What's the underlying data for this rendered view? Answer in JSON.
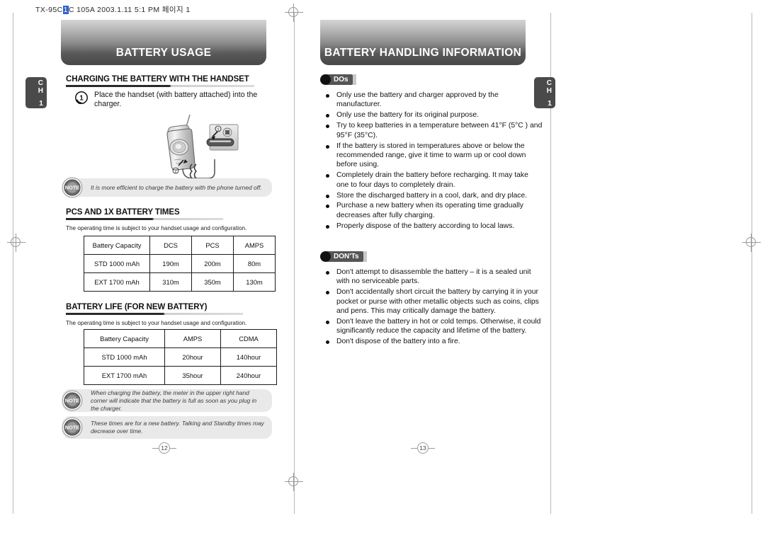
{
  "file_info": {
    "prefix": "TX-95C",
    "highlight": "1",
    "rest": "C 105A  2003.1.11 5:1 PM 페이지 1"
  },
  "left_page": {
    "banner_title": "BATTERY USAGE",
    "chapter_tab": {
      "line1": "C",
      "line2": "H",
      "number": "1"
    },
    "section1": {
      "heading": "CHARGING THE BATTERY WITH THE HANDSET"
    },
    "step1": {
      "number": "1",
      "text": "Place the handset (with battery attached) into the charger."
    },
    "note1": {
      "badge": "NOTE",
      "text": "It is more efficient to charge the battery with the phone turned off."
    },
    "section2": {
      "heading": "PCS AND 1X BATTERY TIMES",
      "caption": "The operating time is subject to your handset usage and configuration.",
      "table": {
        "headers": [
          "Battery Capacity",
          "DCS",
          "PCS",
          "AMPS"
        ],
        "rows": [
          [
            "STD 1000 mAh",
            "190m",
            "200m",
            "80m"
          ],
          [
            "EXT 1700 mAh",
            "310m",
            "350m",
            "130m"
          ]
        ]
      }
    },
    "section3": {
      "heading": "BATTERY LIFE (FOR NEW BATTERY)",
      "caption": "The operating time is subject to your handset usage and configuration.",
      "table": {
        "headers": [
          "Battery Capacity",
          "AMPS",
          "CDMA"
        ],
        "rows": [
          [
            "STD 1000 mAh",
            "20hour",
            "140hour"
          ],
          [
            "EXT 1700 mAh",
            "35hour",
            "240hour"
          ]
        ]
      }
    },
    "note2": {
      "badge": "NOTE",
      "text": "When charging the battery, the meter in the upper right hand corner will indicate that the battery is full as soon as you plug in the charger."
    },
    "note3": {
      "badge": "NOTE",
      "text": "These times are for a new battery. Talking and Standby times may decrease over time."
    },
    "page_number": "12"
  },
  "right_page": {
    "banner_title": "BATTERY HANDLING INFORMATION",
    "chapter_tab": {
      "line1": "C",
      "line2": "H",
      "number": "1"
    },
    "dos": {
      "label": "DOs",
      "items": [
        "Only use the battery and charger approved by the manufacturer.",
        "Only use the battery for its original purpose.",
        "Try to keep batteries in a temperature between 41°F (5°C ) and 95°F (35°C).",
        "If the battery is stored in temperatures above or below the recommended range, give it time to warm up or cool down before using.",
        "Completely drain the battery before recharging. It may take one to four days to completely drain.",
        "Store the discharged battery in a cool, dark, and dry place.",
        "Purchase a new battery when its operating time gradually decreases after fully charging.",
        "Properly dispose of the battery according to local laws."
      ]
    },
    "donts": {
      "label": "DON'Ts",
      "items": [
        "Don't attempt to disassemble the battery – it is a sealed unit with no serviceable parts.",
        "Don't accidentally short circuit the battery by carrying it in your pocket or purse with other metallic objects such as coins, clips and pens. This may critically damage the battery.",
        "Don't leave the battery in hot or cold temps. Otherwise, it could significantly reduce the capacity and lifetime of the battery.",
        "Don't dispose of the battery into a fire."
      ]
    },
    "page_number": "13"
  }
}
